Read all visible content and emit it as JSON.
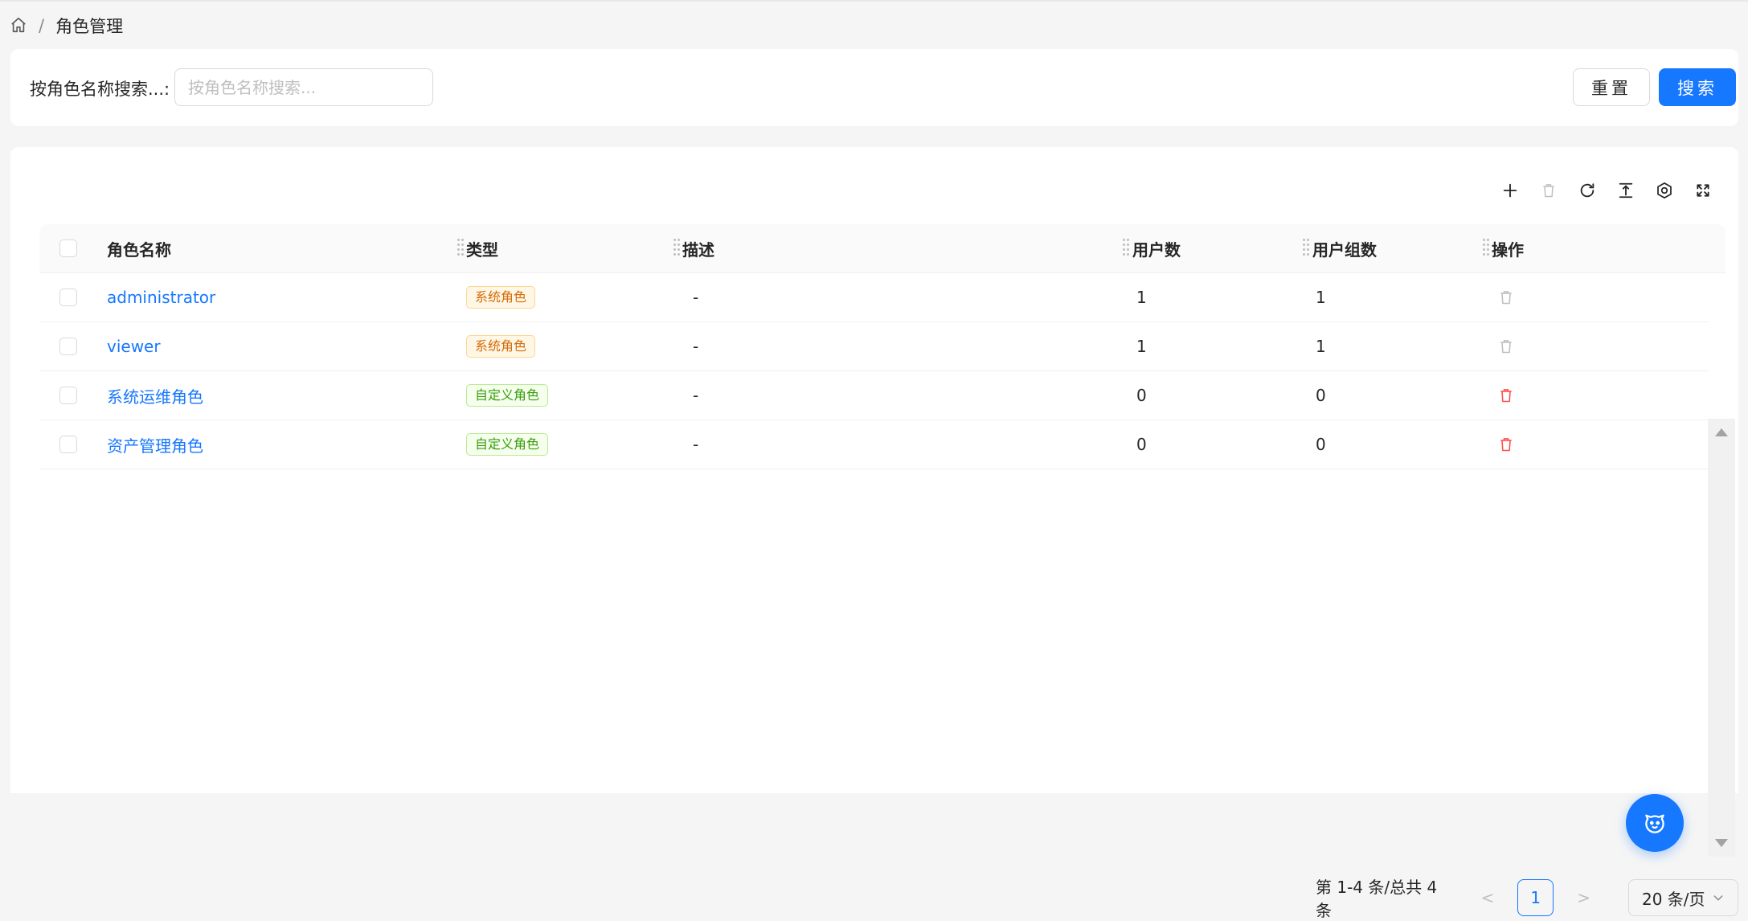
{
  "breadcrumb": {
    "home_icon": "home-icon",
    "separator": "/",
    "current": "角色管理"
  },
  "search": {
    "label": "按角色名称搜索...:",
    "placeholder": "按角色名称搜索...",
    "value": "",
    "reset_label": "重置",
    "search_label": "搜索"
  },
  "toolbar": {
    "icons": [
      "plus-icon",
      "trash-icon",
      "reload-icon",
      "column-height-icon",
      "setting-icon",
      "fullscreen-icon"
    ]
  },
  "table": {
    "columns": [
      "角色名称",
      "类型",
      "描述",
      "用户数",
      "用户组数",
      "操作"
    ],
    "rows": [
      {
        "name": "administrator",
        "type": "系统角色",
        "type_kind": "system",
        "desc": "-",
        "users": "1",
        "groups": "1",
        "deletable": false
      },
      {
        "name": "viewer",
        "type": "系统角色",
        "type_kind": "system",
        "desc": "-",
        "users": "1",
        "groups": "1",
        "deletable": false
      },
      {
        "name": "系统运维角色",
        "type": "自定义角色",
        "type_kind": "custom",
        "desc": "-",
        "users": "0",
        "groups": "0",
        "deletable": true
      },
      {
        "name": "资产管理角色",
        "type": "自定义角色",
        "type_kind": "custom",
        "desc": "-",
        "users": "0",
        "groups": "0",
        "deletable": true
      }
    ]
  },
  "pagination": {
    "summary": "第 1-4 条/总共 4 条",
    "prev": "<",
    "current_page": "1",
    "next": ">",
    "page_size": "20 条/页"
  },
  "colors": {
    "primary": "#1677ff",
    "danger": "#ff4d4f",
    "disabled": "#bfbfbf",
    "tag_system": "#d46b08",
    "tag_custom": "#389e0d"
  },
  "fab": {
    "icon": "assistant-icon"
  }
}
